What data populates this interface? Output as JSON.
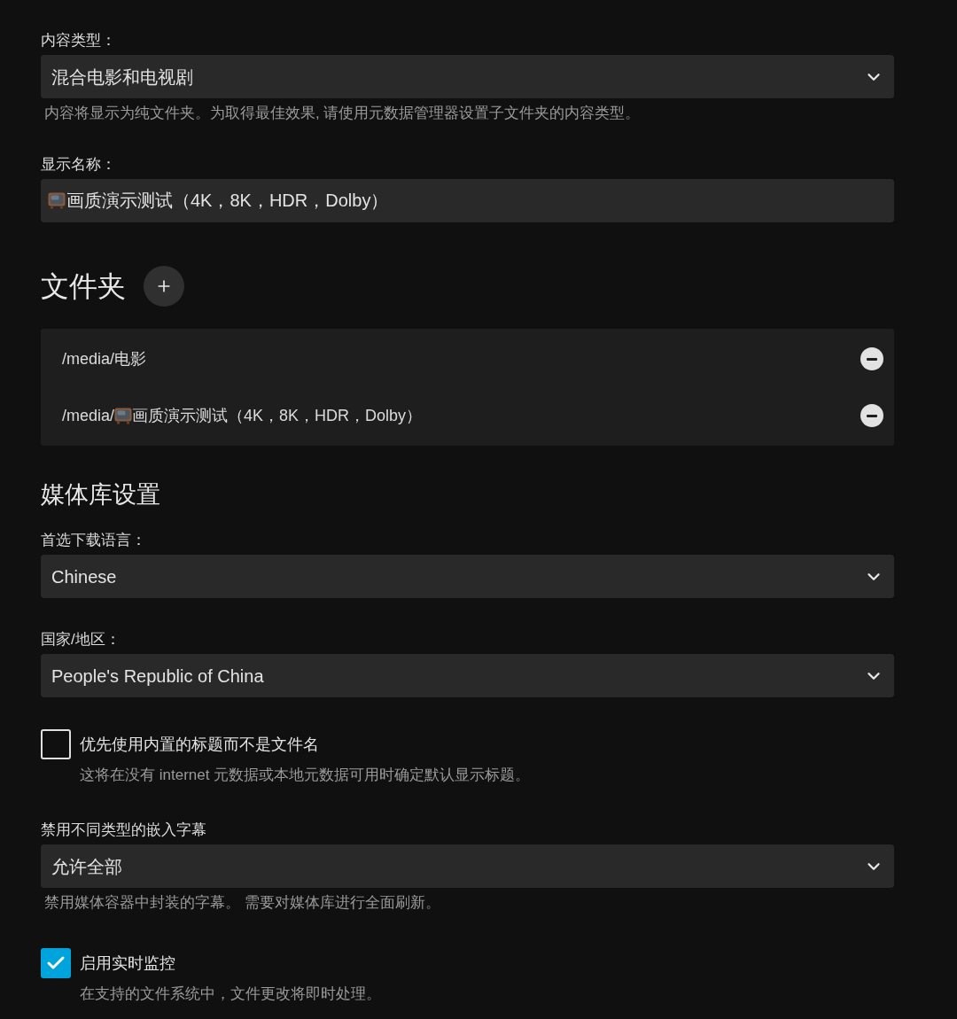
{
  "general": {
    "fields": [
      {
        "kind": "select",
        "label": "内容类型：",
        "value": "混合电影和电视剧",
        "description": "内容将显示为纯文件夹。为取得最佳效果, 请使用元数据管理器设置子文件夹的内容类型。"
      },
      {
        "kind": "text",
        "label": "显示名称：",
        "value": "画质演示测试（4K，8K，HDR，Dolby）"
      }
    ]
  },
  "folders": {
    "title": "文件夹",
    "items": [
      {
        "path": "/media/电影"
      },
      {
        "path": "/media/",
        "name": "画质演示测试（4K，8K，HDR，Dolby）"
      }
    ]
  },
  "library_settings": {
    "title": "媒体库设置",
    "fields": [
      {
        "kind": "select",
        "label": "首选下载语言：",
        "value": "Chinese"
      },
      {
        "kind": "select",
        "label": "国家/地区：",
        "value": "People's Republic of China"
      },
      {
        "kind": "checkbox",
        "label": "优先使用内置的标题而不是文件名",
        "checked": false,
        "description": "这将在没有 internet 元数据或本地元数据可用时确定默认显示标题。"
      },
      {
        "kind": "select",
        "label": "禁用不同类型的嵌入字幕",
        "value": "允许全部",
        "description": "禁用媒体容器中封装的字幕。 需要对媒体库进行全面刷新。"
      },
      {
        "kind": "checkbox",
        "label": "启用实时监控",
        "checked": true,
        "description": "在支持的文件系统中，文件更改将即时处理。"
      }
    ]
  }
}
